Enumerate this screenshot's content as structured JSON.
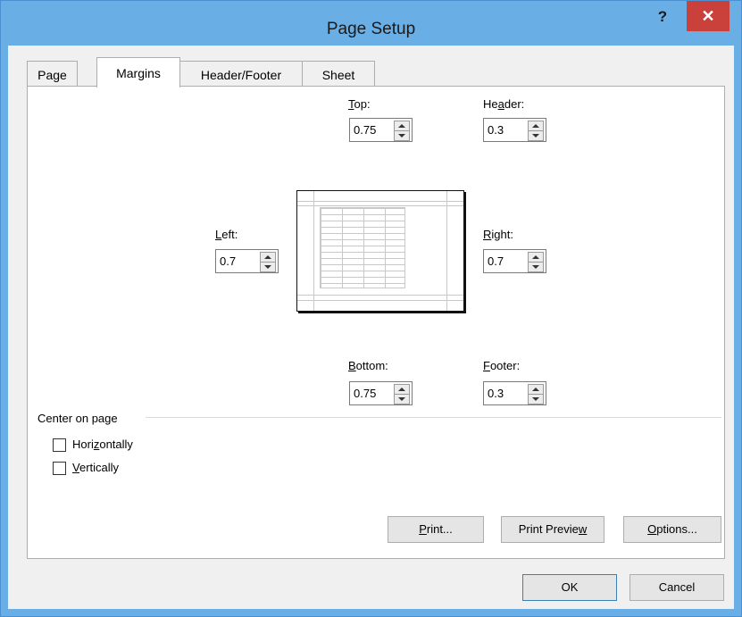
{
  "window": {
    "title": "Page Setup",
    "help_label": "?",
    "close_label": "✕"
  },
  "tabs": [
    {
      "label": "Page",
      "active": false
    },
    {
      "label": "Margins",
      "active": true
    },
    {
      "label": "Header/Footer",
      "active": false
    },
    {
      "label": "Sheet",
      "active": false
    }
  ],
  "margins": {
    "top": {
      "label_mn": "T",
      "label_rest": "op:",
      "value": "0.75"
    },
    "header": {
      "label_pre": "He",
      "label_mn": "a",
      "label_rest": "der:",
      "value": "0.3"
    },
    "left": {
      "label_mn": "L",
      "label_rest": "eft:",
      "value": "0.7"
    },
    "right": {
      "label_mn": "R",
      "label_rest": "ight:",
      "value": "0.7"
    },
    "bottom": {
      "label_mn": "B",
      "label_rest": "ottom:",
      "value": "0.75"
    },
    "footer": {
      "label_mn": "F",
      "label_rest": "ooter:",
      "value": "0.3"
    }
  },
  "center_on_page": {
    "title": "Center on page",
    "horizontally": {
      "label_pre": "Hori",
      "label_mn": "z",
      "label_rest": "ontally",
      "checked": false
    },
    "vertically": {
      "label_mn": "V",
      "label_rest": "ertically",
      "checked": false
    }
  },
  "panel_buttons": {
    "print": {
      "label_mn": "P",
      "label_rest": "rint..."
    },
    "print_preview": {
      "label_pre": "Print Previe",
      "label_mn": "w"
    },
    "options": {
      "label_mn": "O",
      "label_rest": "ptions..."
    }
  },
  "dialog_buttons": {
    "ok": "OK",
    "cancel": "Cancel"
  }
}
